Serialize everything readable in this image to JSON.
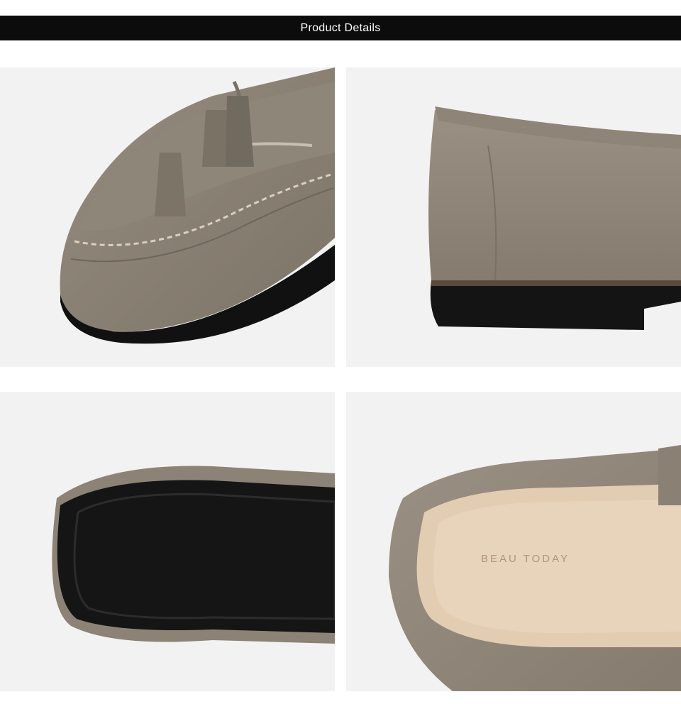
{
  "header": {
    "title": "Product Details"
  },
  "colors": {
    "banner_bg": "#0c0c0c",
    "panel_bg": "#f2f2f2",
    "suede": "#8c8276",
    "sole": "#111111",
    "lining": "#e2cdb3"
  },
  "photos": [
    {
      "name": "toe-tassel-closeup"
    },
    {
      "name": "heel-side-closeup"
    },
    {
      "name": "outsole-closeup"
    },
    {
      "name": "insole-closeup",
      "insole_logo": "BEAU TODAY"
    }
  ]
}
